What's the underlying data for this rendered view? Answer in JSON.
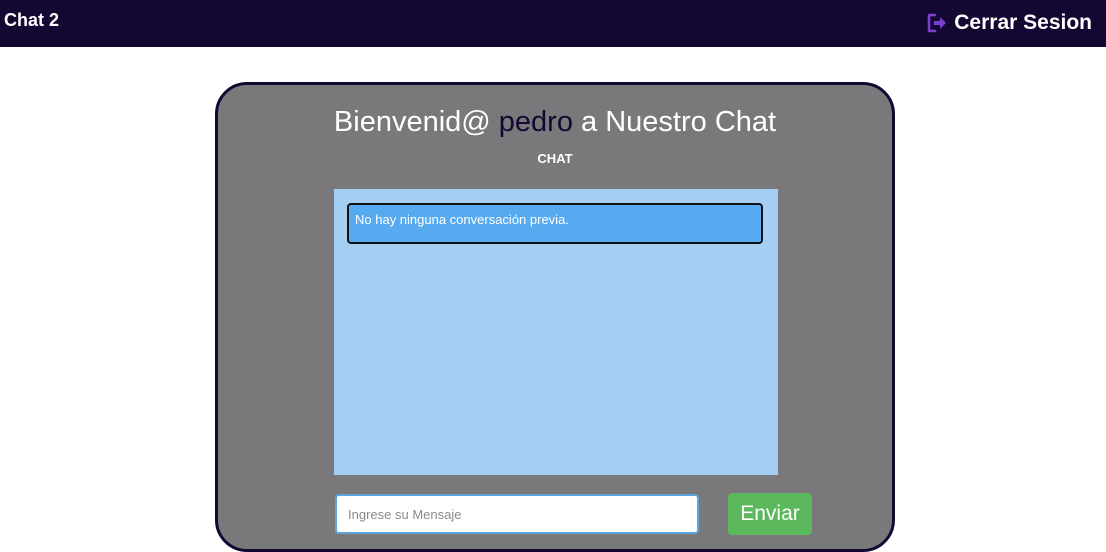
{
  "header": {
    "brand": "Chat 2",
    "logout_label": "Cerrar Sesion",
    "logout_icon": "sign-out-icon",
    "background_color": "#140833",
    "icon_color": "#7b3fd0"
  },
  "card": {
    "welcome_prefix": "Bienvenid@",
    "username": "pedro",
    "welcome_suffix": "a Nuestro Chat",
    "subtitle": "CHAT",
    "background_color": "#79787a"
  },
  "chat": {
    "messages": [
      {
        "text": "No hay ninguna conversación previa."
      }
    ],
    "background_color": "#a4cff3",
    "message_color": "#55aaf0"
  },
  "composer": {
    "placeholder": "Ingrese su Mensaje",
    "value": "",
    "send_label": "Enviar",
    "send_color": "#5cb85c"
  }
}
